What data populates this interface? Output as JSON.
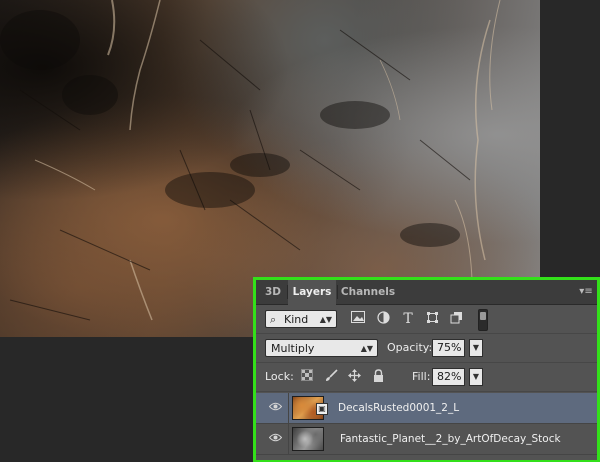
{
  "panel": {
    "tabs": [
      {
        "label": "3D",
        "active": false
      },
      {
        "label": "Layers",
        "active": true
      },
      {
        "label": "Channels",
        "active": false
      }
    ],
    "menu_icon": "panel-menu-icon",
    "filter": {
      "kind_label": "Kind",
      "search_icon": "search-icon",
      "icons": [
        "image-filter-icon",
        "adjustment-filter-icon",
        "type-filter-icon",
        "shape-filter-icon",
        "smart-object-filter-icon"
      ],
      "type_glyph": "T"
    },
    "blend": {
      "mode": "Multiply",
      "opacity_label": "Opacity:",
      "opacity_value": "75%"
    },
    "lock": {
      "label": "Lock:",
      "icons": [
        "lock-transparent-icon",
        "lock-image-icon",
        "lock-position-icon",
        "lock-all-icon"
      ],
      "fill_label": "Fill:",
      "fill_value": "82%"
    },
    "layers": [
      {
        "name": "DecalsRusted0001_2_L",
        "selected": true,
        "visible": true,
        "smart_object": true
      },
      {
        "name": "Fantastic_Planet__2_by_ArtOfDecay_Stock",
        "selected": false,
        "visible": true,
        "smart_object": false
      }
    ]
  },
  "colors": {
    "highlight_border": "#33e01a",
    "panel_bg": "#535353",
    "selected_row": "#5e6a7e",
    "workspace_bg": "#282828"
  }
}
